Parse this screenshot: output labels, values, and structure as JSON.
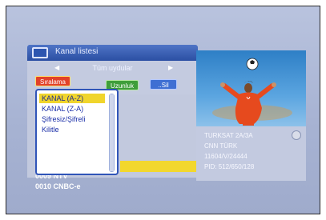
{
  "panel": {
    "title": "Kanal listesi",
    "satellite": "Tüm uydular",
    "buttons": {
      "red": "Sıralama",
      "green": "Uzunluk",
      "blue": "..Sil"
    }
  },
  "sort_menu": {
    "items": [
      {
        "label": "KANAL (A-Z)",
        "selected": true
      },
      {
        "label": "KANAL (Z-A)"
      },
      {
        "label": "Şifresiz/Şifreli"
      },
      {
        "label": "Kilitle"
      }
    ]
  },
  "channels": [
    {
      "number_name": "0009 NTV"
    },
    {
      "number_name": "0010 CNBC-e"
    }
  ],
  "info": {
    "satellite": "TURKSAT 2A/3A",
    "channel": "CNN TÜRK",
    "frequency": "11604/V/24444",
    "pids": "PID: 512/650/128"
  },
  "colors": {
    "header_blue": "#2b4fa3",
    "highlight_yellow": "#f0d52c",
    "panel": "#c4cbe0"
  }
}
